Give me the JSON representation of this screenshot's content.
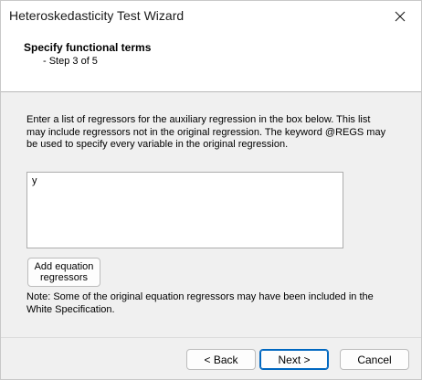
{
  "window": {
    "title": "Heteroskedasticity Test Wizard"
  },
  "header": {
    "step_title": "Specify functional terms",
    "step_subtitle": "- Step 3 of 5"
  },
  "main": {
    "description": "Enter a list of regressors for the auxiliary regression in the box below. This list may include regressors not in the original regression. The keyword @REGS may be used to specify every variable in the original regression.",
    "regressors_value": "y",
    "add_button_label": "Add equation regressors",
    "note": "Note: Some of the original equation regressors may have been included in the White Specification."
  },
  "footer": {
    "back_label": "< Back",
    "next_label": "Next >",
    "cancel_label": "Cancel"
  },
  "icons": {
    "close": "close-icon"
  },
  "colors": {
    "dialog_background": "#f0f0f0",
    "default_button_border": "#0067c0"
  }
}
